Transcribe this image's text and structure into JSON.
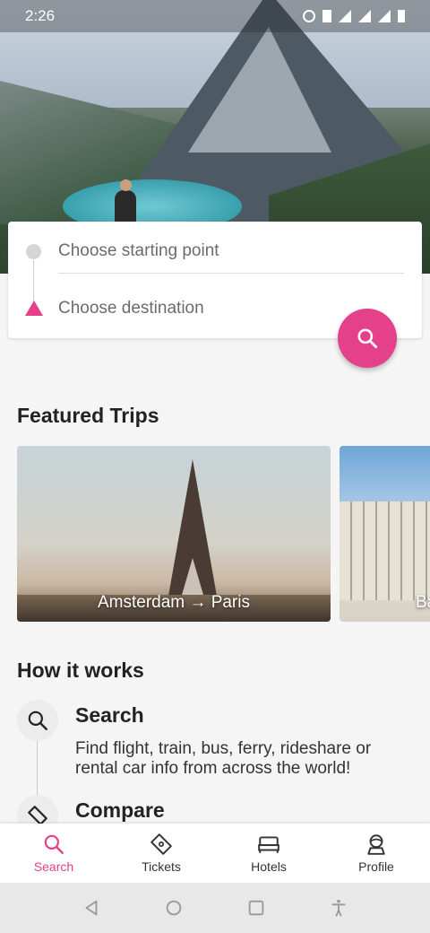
{
  "status_bar": {
    "time": "2:26"
  },
  "search": {
    "start_placeholder": "Choose starting point",
    "destination_placeholder": "Choose destination"
  },
  "featured": {
    "title": "Featured Trips",
    "trips": [
      {
        "label": "Amsterdam → Paris"
      },
      {
        "label": "Ba"
      }
    ]
  },
  "how_it_works": {
    "title": "How it works",
    "steps": [
      {
        "title": "Search",
        "description": "Find flight, train, bus, ferry, rideshare or rental car info from across the world!",
        "icon": "search-icon"
      },
      {
        "title": "Compare",
        "icon": "ticket-icon"
      }
    ]
  },
  "bottom_nav": {
    "items": [
      {
        "label": "Search",
        "icon": "search-icon",
        "active": true
      },
      {
        "label": "Tickets",
        "icon": "ticket-icon",
        "active": false
      },
      {
        "label": "Hotels",
        "icon": "bed-icon",
        "active": false
      },
      {
        "label": "Profile",
        "icon": "profile-icon",
        "active": false
      }
    ]
  },
  "colors": {
    "accent": "#e5408a",
    "background": "#f5f5f5"
  }
}
